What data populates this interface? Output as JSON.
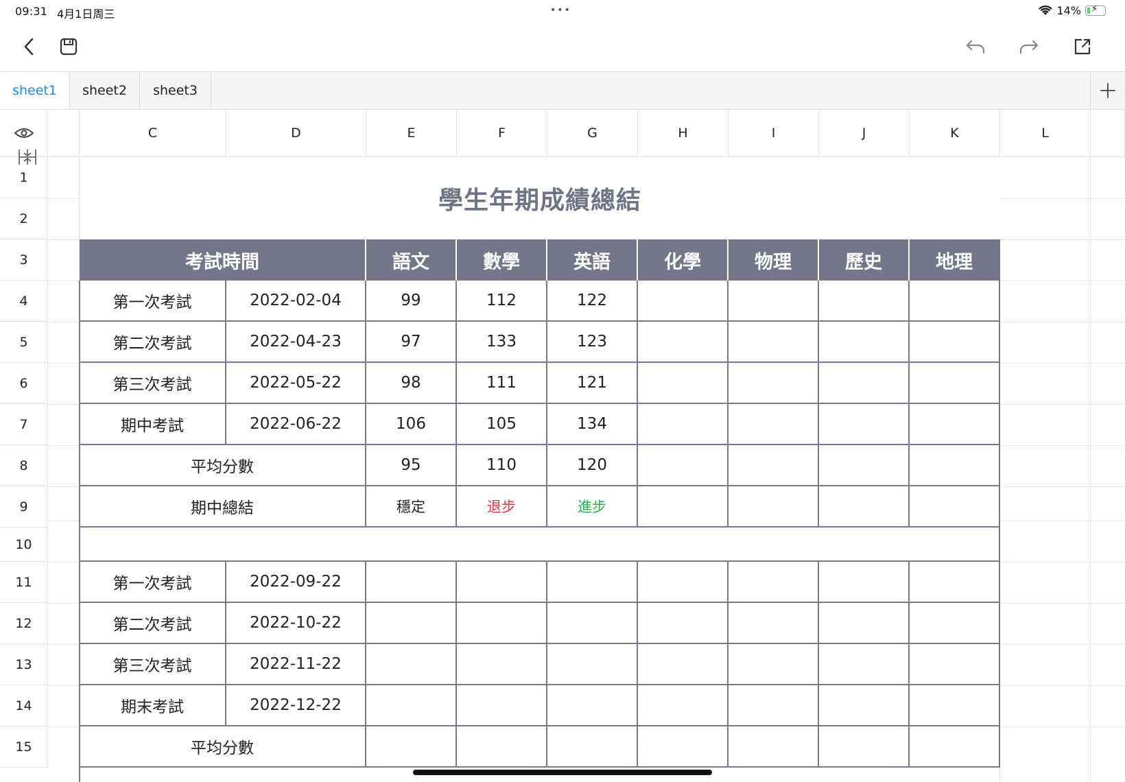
{
  "status": {
    "time": "09:31",
    "date": "4月1日周三",
    "battery": "14%"
  },
  "toolbar": {
    "back_icon": "chevron-left-icon",
    "save_icon": "save-icon",
    "undo_icon": "undo-icon",
    "redo_icon": "redo-icon",
    "share_icon": "share-icon"
  },
  "tabs": [
    {
      "label": "sheet1",
      "active": true
    },
    {
      "label": "sheet2",
      "active": false
    },
    {
      "label": "sheet3",
      "active": false
    }
  ],
  "columns": [
    "C",
    "D",
    "E",
    "F",
    "G",
    "H",
    "I",
    "J",
    "K",
    "L"
  ],
  "rows": [
    "1",
    "2",
    "3",
    "4",
    "5",
    "6",
    "7",
    "8",
    "9",
    "10",
    "11",
    "12",
    "13",
    "14",
    "15"
  ],
  "sheet": {
    "title": "學生年期成績總結",
    "header": [
      "考試時間",
      "語文",
      "數學",
      "英語",
      "化學",
      "物理",
      "歷史",
      "地理"
    ],
    "exams_first_half": [
      {
        "name": "第一次考試",
        "date": "2022-02-04",
        "scores": [
          "99",
          "112",
          "122"
        ]
      },
      {
        "name": "第二次考試",
        "date": "2022-04-23",
        "scores": [
          "97",
          "133",
          "123"
        ]
      },
      {
        "name": "第三次考試",
        "date": "2022-05-22",
        "scores": [
          "98",
          "111",
          "121"
        ]
      },
      {
        "name": "期中考試",
        "date": "2022-06-22",
        "scores": [
          "106",
          "105",
          "134"
        ]
      }
    ],
    "average_label": "平均分數",
    "average_first_half": [
      "95",
      "110",
      "120"
    ],
    "summary_label": "期中總結",
    "summary": [
      "穩定",
      "退步",
      "進步"
    ],
    "exams_second_half": [
      {
        "name": "第一次考試",
        "date": "2022-09-22"
      },
      {
        "name": "第二次考試",
        "date": "2022-10-22"
      },
      {
        "name": "第三次考試",
        "date": "2022-11-22"
      },
      {
        "name": "期末考試",
        "date": "2022-12-22"
      }
    ],
    "average_label_2": "平均分數"
  },
  "colors": {
    "header_bg": "#737789",
    "accent": "#1e88e5",
    "decline": "#ef3340",
    "improve": "#22b24c"
  }
}
